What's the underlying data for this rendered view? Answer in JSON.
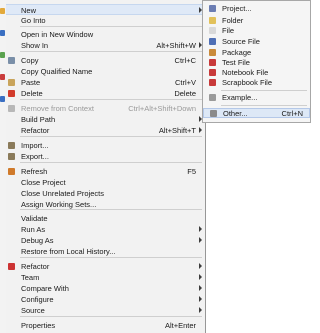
{
  "context_menu": {
    "items": [
      {
        "label": "New",
        "shortcut": "",
        "submenu": true,
        "icon": "",
        "color": "",
        "disabled": false,
        "highlighted": true
      },
      {
        "label": "Go Into",
        "shortcut": "",
        "submenu": false,
        "icon": "",
        "color": "",
        "disabled": false
      },
      {
        "label": "Open in New Window",
        "shortcut": "",
        "submenu": false,
        "icon": "",
        "color": "",
        "disabled": false
      },
      {
        "label": "Show In",
        "shortcut": "Alt+Shift+W",
        "submenu": true,
        "icon": "",
        "color": "",
        "disabled": false
      },
      {
        "label": "Copy",
        "shortcut": "Ctrl+C",
        "submenu": false,
        "icon": "copy-icon",
        "color": "#7a8fa8",
        "disabled": false
      },
      {
        "label": "Copy Qualified Name",
        "shortcut": "",
        "submenu": false,
        "icon": "",
        "color": "",
        "disabled": false
      },
      {
        "label": "Paste",
        "shortcut": "Ctrl+V",
        "submenu": false,
        "icon": "paste-icon",
        "color": "#c9a45b",
        "disabled": false
      },
      {
        "label": "Delete",
        "shortcut": "Delete",
        "submenu": false,
        "icon": "delete-icon",
        "color": "#d23b2b",
        "disabled": false
      },
      {
        "label": "Remove from Context",
        "shortcut": "Ctrl+Alt+Shift+Down",
        "submenu": false,
        "icon": "remove-context-icon",
        "color": "#b8b8b8",
        "disabled": true
      },
      {
        "label": "Build Path",
        "shortcut": "",
        "submenu": true,
        "icon": "",
        "color": "",
        "disabled": false
      },
      {
        "label": "Refactor",
        "shortcut": "Alt+Shift+T",
        "submenu": true,
        "icon": "",
        "color": "",
        "disabled": false
      },
      {
        "label": "Import...",
        "shortcut": "",
        "submenu": false,
        "icon": "import-icon",
        "color": "#8a7a5a",
        "disabled": false
      },
      {
        "label": "Export...",
        "shortcut": "",
        "submenu": false,
        "icon": "export-icon",
        "color": "#8a7a5a",
        "disabled": false
      },
      {
        "label": "Refresh",
        "shortcut": "F5",
        "submenu": false,
        "icon": "refresh-icon",
        "color": "#d07a2a",
        "disabled": false
      },
      {
        "label": "Close Project",
        "shortcut": "",
        "submenu": false,
        "icon": "",
        "color": "",
        "disabled": false
      },
      {
        "label": "Close Unrelated Projects",
        "shortcut": "",
        "submenu": false,
        "icon": "",
        "color": "",
        "disabled": false
      },
      {
        "label": "Assign Working Sets...",
        "shortcut": "",
        "submenu": false,
        "icon": "",
        "color": "",
        "disabled": false
      },
      {
        "label": "Validate",
        "shortcut": "",
        "submenu": false,
        "icon": "",
        "color": "",
        "disabled": false
      },
      {
        "label": "Run As",
        "shortcut": "",
        "submenu": true,
        "icon": "",
        "color": "",
        "disabled": false
      },
      {
        "label": "Debug As",
        "shortcut": "",
        "submenu": true,
        "icon": "",
        "color": "",
        "disabled": false
      },
      {
        "label": "Restore from Local History...",
        "shortcut": "",
        "submenu": false,
        "icon": "",
        "color": "",
        "disabled": false
      },
      {
        "label": "Refactor",
        "shortcut": "",
        "submenu": true,
        "icon": "refactor-icon",
        "color": "#cc3333",
        "disabled": false
      },
      {
        "label": "Team",
        "shortcut": "",
        "submenu": true,
        "icon": "",
        "color": "",
        "disabled": false
      },
      {
        "label": "Compare With",
        "shortcut": "",
        "submenu": true,
        "icon": "",
        "color": "",
        "disabled": false
      },
      {
        "label": "Configure",
        "shortcut": "",
        "submenu": true,
        "icon": "",
        "color": "",
        "disabled": false
      },
      {
        "label": "Source",
        "shortcut": "",
        "submenu": true,
        "icon": "",
        "color": "",
        "disabled": false
      },
      {
        "label": "Properties",
        "shortcut": "Alt+Enter",
        "submenu": false,
        "icon": "",
        "color": "",
        "disabled": false
      }
    ]
  },
  "submenu": {
    "items": [
      {
        "label": "Project...",
        "shortcut": "",
        "icon": "project-icon",
        "color": "#6b7db3"
      },
      {
        "label": "Folder",
        "shortcut": "",
        "icon": "folder-icon",
        "color": "#e2c15a"
      },
      {
        "label": "File",
        "shortcut": "",
        "icon": "file-icon",
        "color": "#d9d9d9"
      },
      {
        "label": "Source File",
        "shortcut": "",
        "icon": "source-file-icon",
        "color": "#4f6fb5"
      },
      {
        "label": "Package",
        "shortcut": "",
        "icon": "package-icon",
        "color": "#c98a3a"
      },
      {
        "label": "Test File",
        "shortcut": "",
        "icon": "test-file-icon",
        "color": "#c83a3a"
      },
      {
        "label": "Notebook File",
        "shortcut": "",
        "icon": "notebook-file-icon",
        "color": "#c83a3a"
      },
      {
        "label": "Scrapbook File",
        "shortcut": "",
        "icon": "scrapbook-file-icon",
        "color": "#c83a3a"
      },
      {
        "label": "Example...",
        "shortcut": "",
        "icon": "example-icon",
        "color": "#9a9a9a"
      },
      {
        "label": "Other...",
        "shortcut": "Ctrl+N",
        "icon": "other-icon",
        "color": "#8a8a8a",
        "highlighted": true
      }
    ]
  },
  "background": {
    "icon_colors": [
      "#e3a93a",
      "#3a6fc2",
      "#5aa24f",
      "#c93c3c",
      "#3a6fc2"
    ]
  }
}
